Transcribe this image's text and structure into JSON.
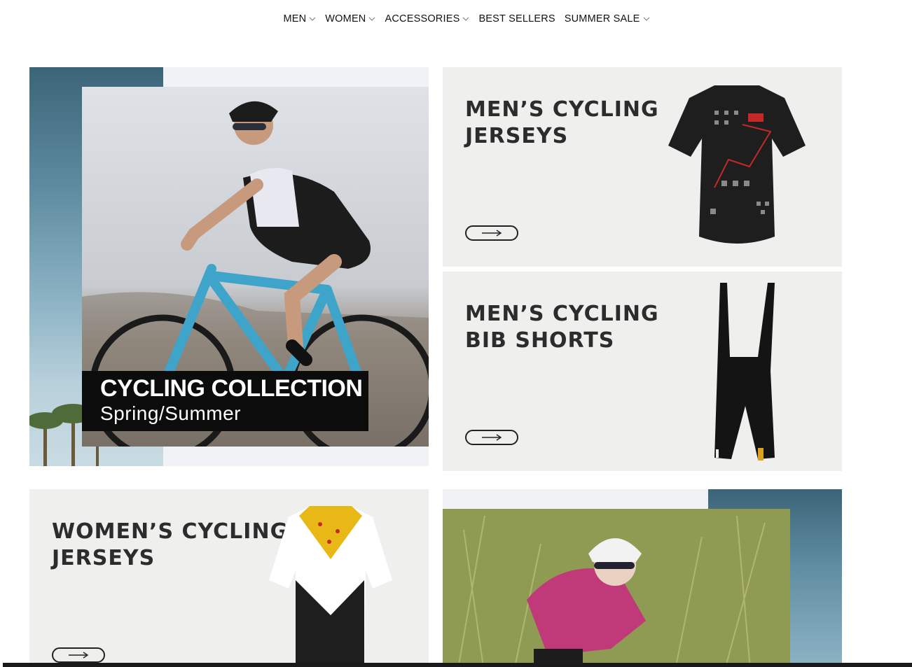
{
  "nav": {
    "items": [
      {
        "label": "MEN",
        "has_dropdown": true
      },
      {
        "label": "WOMEN",
        "has_dropdown": true
      },
      {
        "label": "ACCESSORIES",
        "has_dropdown": true
      },
      {
        "label": "BEST SELLERS",
        "has_dropdown": false
      },
      {
        "label": "SUMMER SALE",
        "has_dropdown": true
      }
    ]
  },
  "hero": {
    "title": "CYCLING COLLECTION",
    "subtitle": "Spring/Summer"
  },
  "tiles": {
    "mens_jerseys": {
      "title_line1": "MEN’S CYCLING",
      "title_line2": "JERSEYS",
      "button_icon": "right-arrow-icon"
    },
    "mens_bib": {
      "title_line1": "MEN’S CYCLING",
      "title_line2": "BIB SHORTS",
      "button_icon": "right-arrow-icon"
    },
    "womens_jerseys": {
      "title_line1": "WOMEN’S CYCLING",
      "title_line2": "JERSEYS",
      "button_icon": "right-arrow-icon"
    }
  },
  "colors": {
    "accent_sky": "#3c6478",
    "tile_bg": "#efefee",
    "caption_bg": "#0c0c0c"
  }
}
